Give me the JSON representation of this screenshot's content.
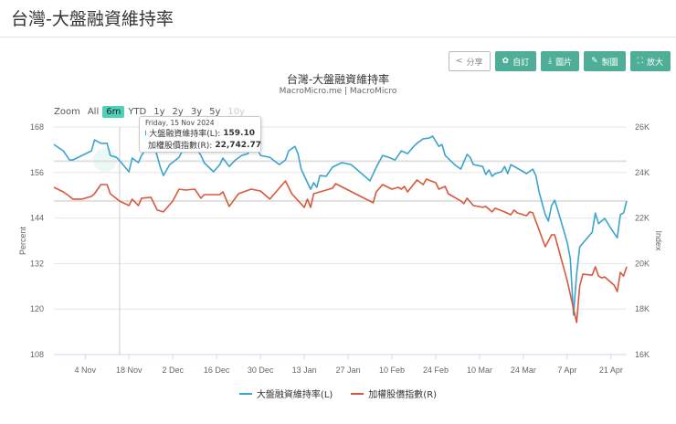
{
  "header": {
    "title": "台灣-大盤融資維持率"
  },
  "toolbar": {
    "share": "分享",
    "custom": "自訂",
    "image": "圖片",
    "draw": "製圖",
    "expand": "放大"
  },
  "zoom": {
    "label": "Zoom",
    "options": [
      "All",
      "6m",
      "YTD",
      "1y",
      "2y",
      "3y",
      "5y",
      "10y"
    ],
    "active": "6m",
    "disabled": [
      "10y"
    ]
  },
  "tooltip": {
    "date": "Friday, 15 Nov 2024",
    "rows": [
      {
        "label": "大盤融資維持率(L):",
        "value": "159.10"
      },
      {
        "label": "加權股價指數(R):",
        "value": "22,742.77"
      }
    ]
  },
  "chart_data": {
    "type": "line",
    "title": "台灣-大盤融資維持率",
    "subtitle": "MacroMicro.me | MacroMicro",
    "x_unit": "days since 2024-10-25",
    "x_range": [
      0,
      183
    ],
    "x_ticks": [
      {
        "day": 10,
        "label": "4 Nov"
      },
      {
        "day": 24,
        "label": "18 Nov"
      },
      {
        "day": 38,
        "label": "2 Dec"
      },
      {
        "day": 52,
        "label": "16 Dec"
      },
      {
        "day": 66,
        "label": "30 Dec"
      },
      {
        "day": 80,
        "label": "13 Jan"
      },
      {
        "day": 94,
        "label": "27 Jan"
      },
      {
        "day": 108,
        "label": "10 Feb"
      },
      {
        "day": 122,
        "label": "24 Feb"
      },
      {
        "day": 136,
        "label": "10 Mar"
      },
      {
        "day": 150,
        "label": "24 Mar"
      },
      {
        "day": 164,
        "label": "7 Apr"
      },
      {
        "day": 178,
        "label": "21 Apr"
      }
    ],
    "y_left": {
      "label": "Percent",
      "range": [
        108,
        168
      ],
      "ticks": [
        "108",
        "120",
        "132",
        "144",
        "156",
        "168"
      ]
    },
    "y_right": {
      "label": "Index",
      "range": [
        16000,
        26000
      ],
      "ticks": [
        "16K",
        "18K",
        "20K",
        "22K",
        "24K",
        "26K"
      ]
    },
    "plot_lines_right": [
      24500,
      22750
    ],
    "crosshair_day": 21,
    "grid": true,
    "legend_position": "bottom",
    "series": [
      {
        "name": "大盤融資維持率(L)",
        "axis": "left",
        "color": "#3ba3d0",
        "points": [
          [
            0,
            163.4
          ],
          [
            3,
            161.7
          ],
          [
            5,
            159.3
          ],
          [
            6,
            159.3
          ],
          [
            9,
            160.5
          ],
          [
            12,
            161.7
          ],
          [
            13,
            164.6
          ],
          [
            15,
            163.7
          ],
          [
            17,
            163.7
          ],
          [
            18,
            160.5
          ],
          [
            20,
            160.0
          ],
          [
            21,
            159.1
          ],
          [
            24,
            156.2
          ],
          [
            25,
            159.8
          ],
          [
            27,
            158.6
          ],
          [
            28,
            160.5
          ],
          [
            30,
            162.9
          ],
          [
            32,
            163.4
          ],
          [
            34,
            157.4
          ],
          [
            35,
            155.2
          ],
          [
            37,
            158.1
          ],
          [
            40,
            160.0
          ],
          [
            41,
            161.7
          ],
          [
            44,
            164.1
          ],
          [
            47,
            160.5
          ],
          [
            48,
            158.6
          ],
          [
            51,
            156.2
          ],
          [
            53,
            158.1
          ],
          [
            54,
            159.8
          ],
          [
            56,
            157.6
          ],
          [
            58,
            159.3
          ],
          [
            60,
            160.5
          ],
          [
            62,
            161.0
          ],
          [
            64,
            164.1
          ],
          [
            66,
            160.5
          ],
          [
            69,
            160.0
          ],
          [
            72,
            158.1
          ],
          [
            74,
            159.3
          ],
          [
            75,
            161.7
          ],
          [
            77,
            162.9
          ],
          [
            78,
            161.0
          ],
          [
            79,
            156.9
          ],
          [
            82,
            151.6
          ],
          [
            83,
            153.3
          ],
          [
            84,
            152.1
          ],
          [
            85,
            155.2
          ],
          [
            87,
            155.0
          ],
          [
            89,
            157.4
          ],
          [
            92,
            158.6
          ],
          [
            95,
            158.1
          ],
          [
            101,
            153.8
          ],
          [
            103,
            157.4
          ],
          [
            105,
            160.5
          ],
          [
            107,
            160.0
          ],
          [
            109,
            159.3
          ],
          [
            110,
            160.5
          ],
          [
            111,
            161.7
          ],
          [
            113,
            161.0
          ],
          [
            115,
            162.9
          ],
          [
            116,
            163.7
          ],
          [
            118,
            164.9
          ],
          [
            120,
            165.1
          ],
          [
            121,
            165.6
          ],
          [
            123,
            162.9
          ],
          [
            124,
            163.4
          ],
          [
            125,
            160.5
          ],
          [
            128,
            158.1
          ],
          [
            130,
            156.9
          ],
          [
            132,
            160.8
          ],
          [
            133,
            160.0
          ],
          [
            134,
            158.1
          ],
          [
            137,
            157.6
          ],
          [
            138,
            155.5
          ],
          [
            139,
            156.7
          ],
          [
            140,
            155.0
          ],
          [
            141,
            155.7
          ],
          [
            143,
            156.2
          ],
          [
            144,
            157.6
          ],
          [
            145,
            155.7
          ],
          [
            146,
            158.1
          ],
          [
            151,
            155.7
          ],
          [
            153,
            156.9
          ],
          [
            154,
            155.2
          ],
          [
            155,
            150.9
          ],
          [
            157,
            144.9
          ],
          [
            158,
            143.2
          ],
          [
            159,
            147.3
          ],
          [
            160,
            148.7
          ],
          [
            161,
            146.1
          ],
          [
            164,
            137.6
          ],
          [
            165,
            133.3
          ],
          [
            166,
            118.4
          ],
          [
            167,
            129.2
          ],
          [
            168,
            136.4
          ],
          [
            171,
            139.3
          ],
          [
            172,
            140.3
          ],
          [
            173,
            145.3
          ],
          [
            174,
            142.5
          ],
          [
            176,
            143.9
          ],
          [
            178,
            141.2
          ],
          [
            180,
            138.8
          ],
          [
            181,
            144.9
          ],
          [
            182,
            145.3
          ],
          [
            183,
            148.5
          ]
        ]
      },
      {
        "name": "加權股價指數(R)",
        "axis": "right",
        "color": "#d9583b",
        "points": [
          [
            0,
            23350
          ],
          [
            3,
            23150
          ],
          [
            5,
            22950
          ],
          [
            6,
            22830
          ],
          [
            9,
            22830
          ],
          [
            12,
            22950
          ],
          [
            13,
            23070
          ],
          [
            15,
            23470
          ],
          [
            17,
            23470
          ],
          [
            18,
            23070
          ],
          [
            21,
            22743
          ],
          [
            24,
            22550
          ],
          [
            25,
            22830
          ],
          [
            27,
            22550
          ],
          [
            28,
            22870
          ],
          [
            31,
            22910
          ],
          [
            33,
            22350
          ],
          [
            35,
            22270
          ],
          [
            38,
            22750
          ],
          [
            40,
            23270
          ],
          [
            42,
            23230
          ],
          [
            45,
            23270
          ],
          [
            47,
            22870
          ],
          [
            48,
            23030
          ],
          [
            53,
            23030
          ],
          [
            54,
            23150
          ],
          [
            56,
            22510
          ],
          [
            59,
            23070
          ],
          [
            63,
            23270
          ],
          [
            66,
            23190
          ],
          [
            69,
            22830
          ],
          [
            74,
            23630
          ],
          [
            76,
            23070
          ],
          [
            80,
            22470
          ],
          [
            81,
            22830
          ],
          [
            82,
            22470
          ],
          [
            83,
            23070
          ],
          [
            89,
            23310
          ],
          [
            90,
            23510
          ],
          [
            94,
            23230
          ],
          [
            102,
            22670
          ],
          [
            103,
            23150
          ],
          [
            105,
            23470
          ],
          [
            108,
            23270
          ],
          [
            110,
            23350
          ],
          [
            111,
            23270
          ],
          [
            112,
            23390
          ],
          [
            113,
            23150
          ],
          [
            116,
            23670
          ],
          [
            118,
            23470
          ],
          [
            119,
            23710
          ],
          [
            122,
            23550
          ],
          [
            123,
            23270
          ],
          [
            125,
            23390
          ],
          [
            126,
            23070
          ],
          [
            130,
            22750
          ],
          [
            131,
            22630
          ],
          [
            132,
            22870
          ],
          [
            134,
            22550
          ],
          [
            137,
            22470
          ],
          [
            138,
            22510
          ],
          [
            140,
            22270
          ],
          [
            141,
            22430
          ],
          [
            144,
            22270
          ],
          [
            146,
            22140
          ],
          [
            147,
            22350
          ],
          [
            148,
            22230
          ],
          [
            151,
            22100
          ],
          [
            152,
            22270
          ],
          [
            153,
            22230
          ],
          [
            157,
            20740
          ],
          [
            159,
            21260
          ],
          [
            160,
            21260
          ],
          [
            164,
            19250
          ],
          [
            167,
            17410
          ],
          [
            168,
            19010
          ],
          [
            169,
            19530
          ],
          [
            172,
            19490
          ],
          [
            173,
            19860
          ],
          [
            174,
            19450
          ],
          [
            175,
            19370
          ],
          [
            176,
            19410
          ],
          [
            179,
            19050
          ],
          [
            180,
            18770
          ],
          [
            181,
            19610
          ],
          [
            182,
            19450
          ],
          [
            183,
            19860
          ]
        ]
      }
    ]
  }
}
